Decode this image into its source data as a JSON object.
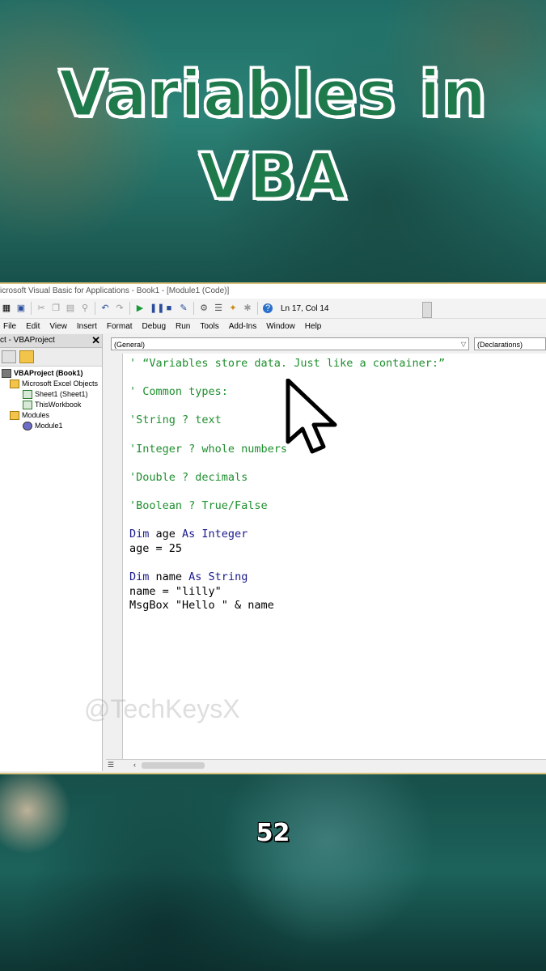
{
  "title": {
    "line1": "Variables in",
    "line2": "VBA",
    "color": "#1e7a4a"
  },
  "window": {
    "title": "icrosoft Visual Basic for Applications - Book1 - [Module1 (Code)]",
    "position_text": "Ln 17, Col 14",
    "menu": [
      "File",
      "Edit",
      "View",
      "Insert",
      "Format",
      "Debug",
      "Run",
      "Tools",
      "Add-Ins",
      "Window",
      "Help"
    ]
  },
  "project_pane": {
    "header": "ct - VBAProject",
    "close": "✕",
    "tree": [
      {
        "label": "VBAProject (Book1)",
        "icon": "project-icon",
        "indent": 0,
        "bold": true
      },
      {
        "label": "Microsoft Excel Objects",
        "icon": "folder-icon",
        "indent": 1
      },
      {
        "label": "Sheet1 (Sheet1)",
        "icon": "sheet-icon",
        "indent": 2
      },
      {
        "label": "ThisWorkbook",
        "icon": "sheet-icon",
        "indent": 2
      },
      {
        "label": "Modules",
        "icon": "folder-icon",
        "indent": 1
      },
      {
        "label": "Module1",
        "icon": "module-icon",
        "indent": 2
      }
    ]
  },
  "code_window": {
    "object_combo": "(General)",
    "proc_combo": "(Declarations)",
    "lines": [
      {
        "parts": [
          {
            "text": "' “Variables store data. Just like a container:”",
            "kind": "comment"
          }
        ]
      },
      {
        "parts": [
          {
            "text": "",
            "kind": "plain"
          }
        ]
      },
      {
        "parts": [
          {
            "text": "' Common types:",
            "kind": "comment"
          }
        ]
      },
      {
        "parts": [
          {
            "text": "",
            "kind": "plain"
          }
        ]
      },
      {
        "parts": [
          {
            "text": "'String ? text",
            "kind": "comment"
          }
        ]
      },
      {
        "parts": [
          {
            "text": "",
            "kind": "plain"
          }
        ]
      },
      {
        "parts": [
          {
            "text": "'Integer ? whole numbers",
            "kind": "comment"
          }
        ]
      },
      {
        "parts": [
          {
            "text": "",
            "kind": "plain"
          }
        ]
      },
      {
        "parts": [
          {
            "text": "'Double ? decimals",
            "kind": "comment"
          }
        ]
      },
      {
        "parts": [
          {
            "text": "",
            "kind": "plain"
          }
        ]
      },
      {
        "parts": [
          {
            "text": "'Boolean ? True/False",
            "kind": "comment"
          }
        ]
      },
      {
        "parts": [
          {
            "text": "",
            "kind": "plain"
          }
        ]
      },
      {
        "parts": [
          {
            "text": "Dim",
            "kind": "keyword"
          },
          {
            "text": " age ",
            "kind": "plain"
          },
          {
            "text": "As Integer",
            "kind": "keyword"
          }
        ]
      },
      {
        "parts": [
          {
            "text": "age = 25",
            "kind": "plain"
          }
        ]
      },
      {
        "parts": [
          {
            "text": "",
            "kind": "plain"
          }
        ]
      },
      {
        "parts": [
          {
            "text": "Dim",
            "kind": "keyword"
          },
          {
            "text": " name ",
            "kind": "plain"
          },
          {
            "text": "As String",
            "kind": "keyword"
          }
        ]
      },
      {
        "parts": [
          {
            "text": "name = \"lilly\"",
            "kind": "plain"
          }
        ]
      },
      {
        "parts": [
          {
            "text": "MsgBox \"Hello \" & name",
            "kind": "plain"
          }
        ]
      }
    ]
  },
  "watermark": "@TechKeysX",
  "page_number": "52"
}
